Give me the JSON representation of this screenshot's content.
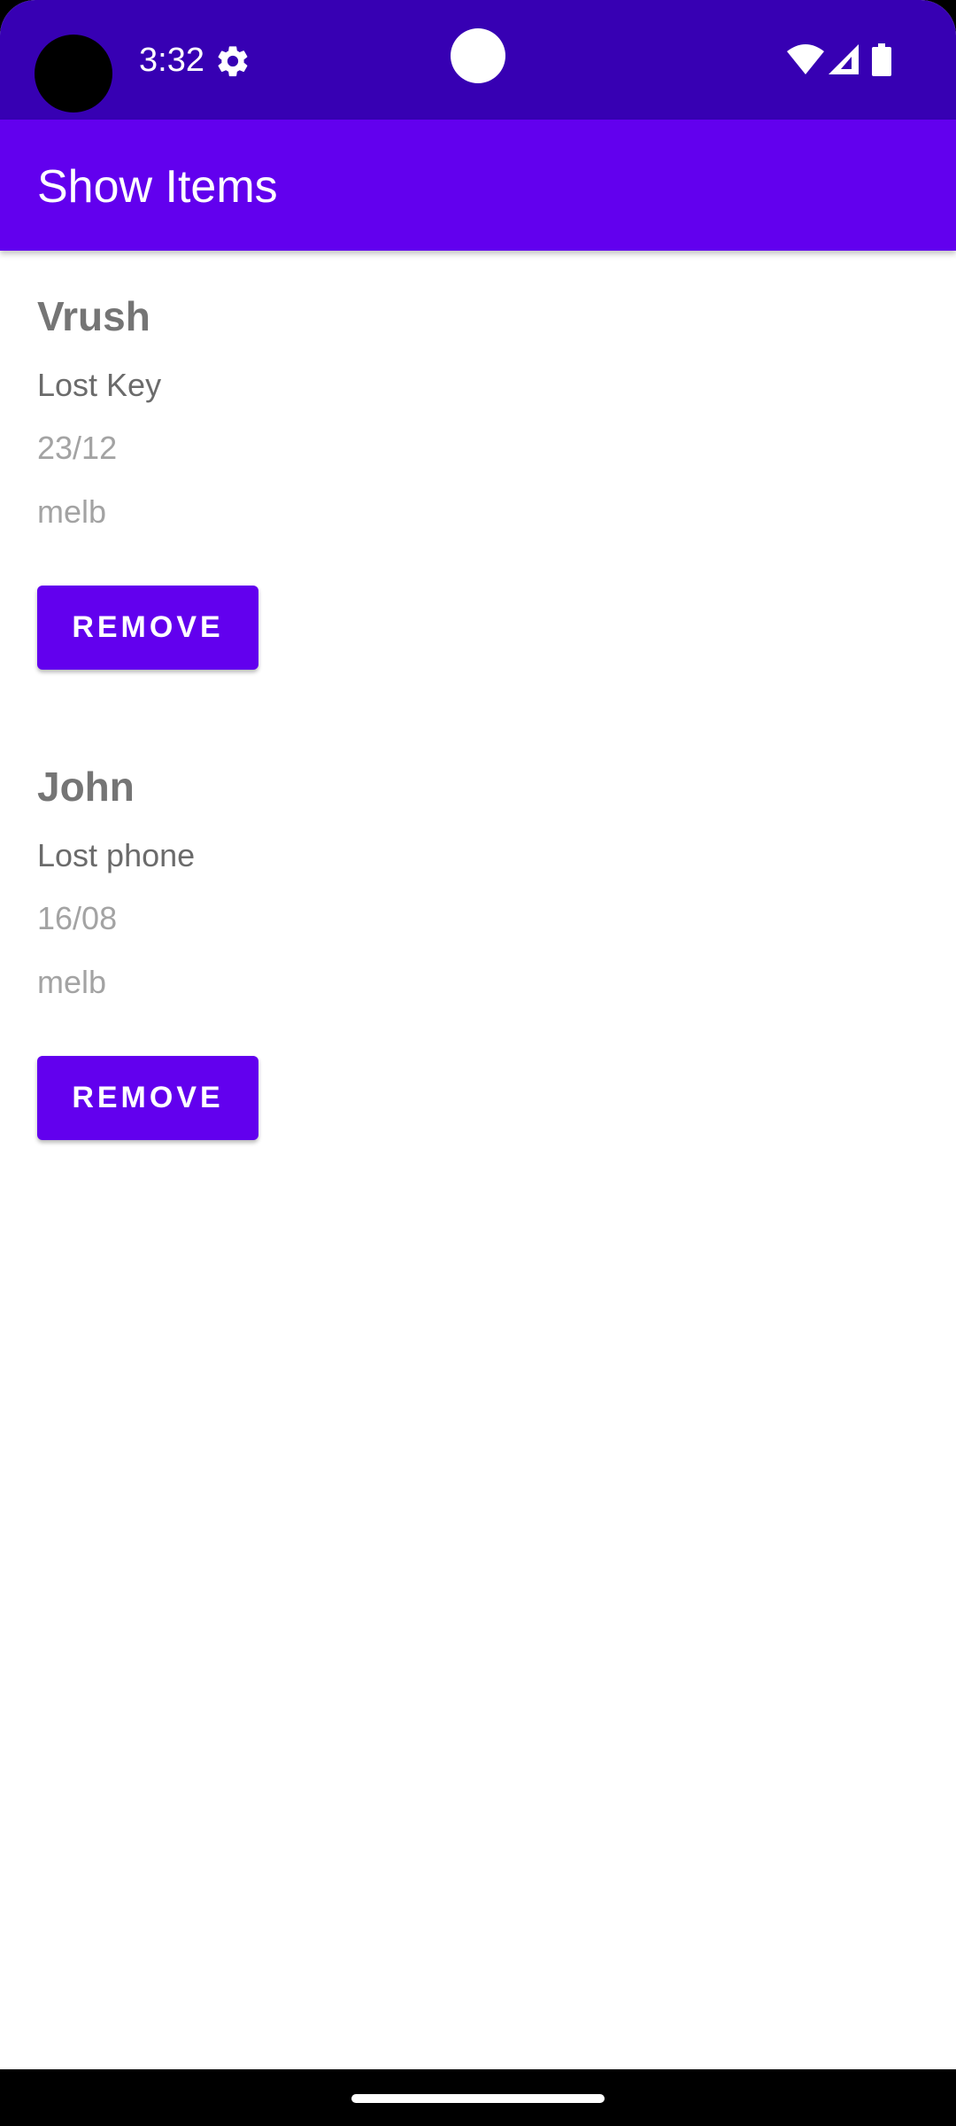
{
  "status_bar": {
    "time": "3:32",
    "icons": [
      "gear-icon",
      "wifi-icon",
      "cellular-signal-icon",
      "battery-icon"
    ]
  },
  "app_bar": {
    "title": "Show Items"
  },
  "items": [
    {
      "name": "Vrush",
      "description": "Lost Key",
      "date": "23/12",
      "location": "melb",
      "button_label": "REMOVE"
    },
    {
      "name": "John",
      "description": "Lost phone",
      "date": "16/08",
      "location": "melb",
      "button_label": "REMOVE"
    }
  ],
  "colors": {
    "status_bar": "#3700b3",
    "primary": "#6200ee",
    "background": "#ffffff"
  }
}
